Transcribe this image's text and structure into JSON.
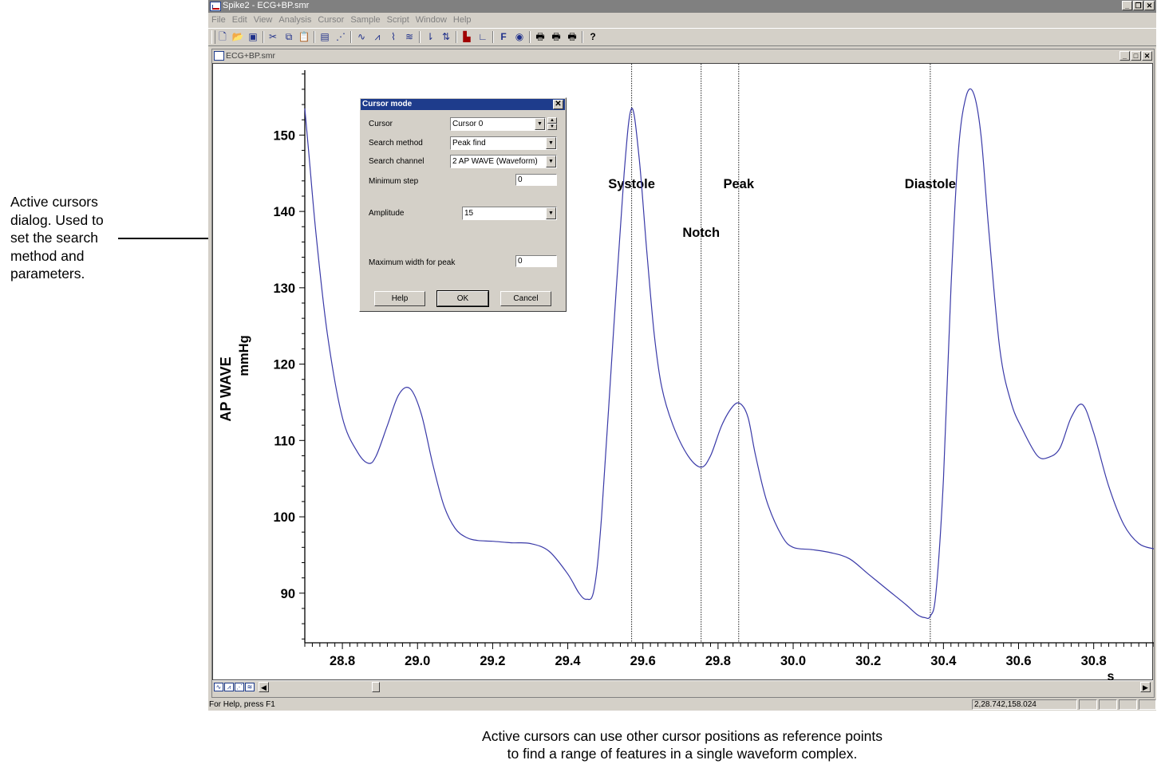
{
  "annotation": {
    "left_text": "Active cursors\ndialog. Used to\nset the search\nmethod and\nparameters.",
    "caption": "Active cursors can use other cursor positions as reference points\nto find a range of features in a single waveform complex."
  },
  "app": {
    "title": "Spike2 - ECG+BP.smr",
    "menu": [
      "File",
      "Edit",
      "View",
      "Analysis",
      "Cursor",
      "Sample",
      "Script",
      "Window",
      "Help"
    ],
    "toolbar_icons": [
      "new-file",
      "open-file",
      "save",
      "cut",
      "copy",
      "paste",
      "new-view",
      "xy-view",
      "waveform-1",
      "waveform-2",
      "waveform-3",
      "waveform-4",
      "cursor-1",
      "cursor-2",
      "histogram",
      "axis",
      "function-f",
      "record",
      "print-1",
      "print-2",
      "print-3",
      "help-question"
    ]
  },
  "child_window": {
    "title": "ECG+BP.smr"
  },
  "chart_data": {
    "type": "line",
    "ylabel": "AP WAVE",
    "yunit": "mmHg",
    "xunit": "s",
    "x_ticks": [
      "28.8",
      "29.0",
      "29.2",
      "29.4",
      "29.6",
      "29.8",
      "30.0",
      "30.2",
      "30.4",
      "30.6",
      "30.8"
    ],
    "y_ticks": [
      "90",
      "100",
      "110",
      "120",
      "130",
      "140",
      "150"
    ],
    "xlim": [
      28.7,
      30.96
    ],
    "ylim": [
      83.5,
      158.5
    ],
    "line_color": "#3a3aa8",
    "series": [
      {
        "x": [
          28.7,
          28.71,
          28.73,
          28.76,
          28.8,
          28.84,
          28.87,
          28.89,
          28.92,
          28.95,
          28.98,
          29.01,
          29.04,
          29.07,
          29.1,
          29.13,
          29.16,
          29.2,
          29.25,
          29.3,
          29.35,
          29.4,
          29.43,
          29.45,
          29.47,
          29.49,
          29.52,
          29.55,
          29.57,
          29.59,
          29.61,
          29.63,
          29.65,
          29.68,
          29.72,
          29.755,
          29.78,
          29.81,
          29.84,
          29.86,
          29.88,
          29.9,
          29.93,
          29.97,
          30.0,
          30.05,
          30.1,
          30.15,
          30.2,
          30.25,
          30.3,
          30.33,
          30.35,
          30.365,
          30.38,
          30.4,
          30.42,
          30.44,
          30.46,
          30.48,
          30.5,
          30.52,
          30.55,
          30.58,
          30.61,
          30.65,
          30.68,
          30.71,
          30.74,
          30.77,
          30.8,
          30.84,
          30.88,
          30.92,
          30.96
        ],
        "y": [
          153.5,
          148,
          137,
          124,
          113,
          108.5,
          107,
          108,
          112,
          116,
          116.8,
          113.5,
          107,
          101.5,
          98.5,
          97.3,
          96.9,
          96.8,
          96.6,
          96.5,
          95.5,
          92.5,
          90,
          89.2,
          90.5,
          100,
          123,
          145,
          153.5,
          147,
          135,
          124,
          117,
          112,
          108,
          106.5,
          108,
          112,
          114.5,
          114.8,
          113,
          108,
          102,
          97.5,
          96,
          95.7,
          95.3,
          94.5,
          92.5,
          90.5,
          88.5,
          87.2,
          86.8,
          87,
          90,
          105,
          130,
          148,
          155,
          155.5,
          150,
          138,
          122,
          115,
          111.5,
          108,
          107.8,
          109,
          113,
          114.7,
          111,
          104,
          99,
          96.5,
          95.8
        ]
      }
    ],
    "cursors": [
      {
        "x": 29.57,
        "label": "Systole"
      },
      {
        "x": 29.755,
        "label": "Notch"
      },
      {
        "x": 29.855,
        "label": "Peak"
      },
      {
        "x": 30.365,
        "label": "Diastole"
      }
    ]
  },
  "dialog": {
    "title": "Cursor mode",
    "cursor_label": "Cursor",
    "cursor_value": "Cursor 0",
    "search_method_label": "Search method",
    "search_method_value": "Peak find",
    "search_channel_label": "Search channel",
    "search_channel_value": "2 AP WAVE (Waveform)",
    "minimum_step_label": "Minimum step",
    "minimum_step_value": "0",
    "amplitude_label": "Amplitude",
    "amplitude_value": "15",
    "max_width_label": "Maximum width for peak",
    "max_width_value": "0",
    "help_label": "Help",
    "ok_label": "OK",
    "cancel_label": "Cancel"
  },
  "status": {
    "help_text": "For Help, press F1",
    "readout": "2,28.742,158.024"
  }
}
